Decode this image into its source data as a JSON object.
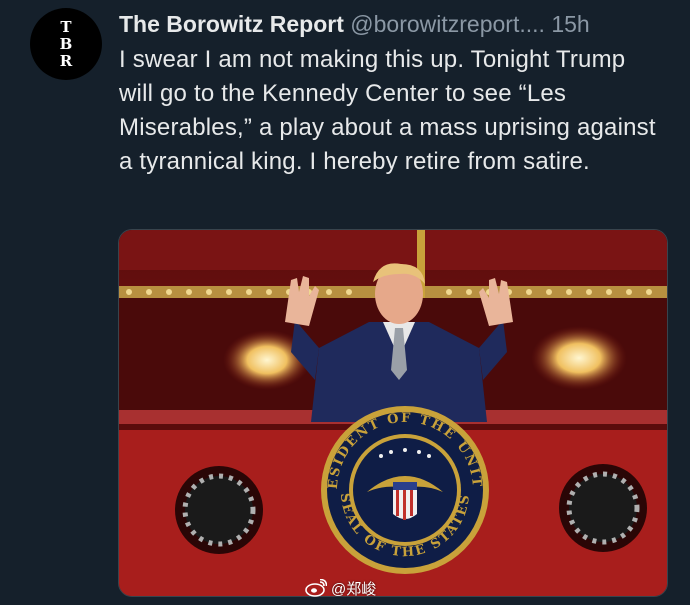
{
  "tweet": {
    "avatar_letters": [
      "T",
      "B",
      "R"
    ],
    "author_name": "The Borowitz Report",
    "author_handle": "@borowitzreport....",
    "timestamp": "15h",
    "text": "I swear I am not making this up. Tonight Trump will go to the Kennedy Center to see “Les Miserables,” a play about a mass uprising against a tyrannical king. I hereby retire from satire."
  },
  "photo": {
    "seal_text_top": "PRESIDENT OF THE UNITED",
    "seal_text_bottom": "SEAL OF THE STATES",
    "colors": {
      "theater_red": "#8b1a1a",
      "suit": "#1f2a5c",
      "seal_gold": "#c9a23a"
    }
  },
  "watermark": {
    "icon": "weibo-icon",
    "text": "@郑峻"
  }
}
